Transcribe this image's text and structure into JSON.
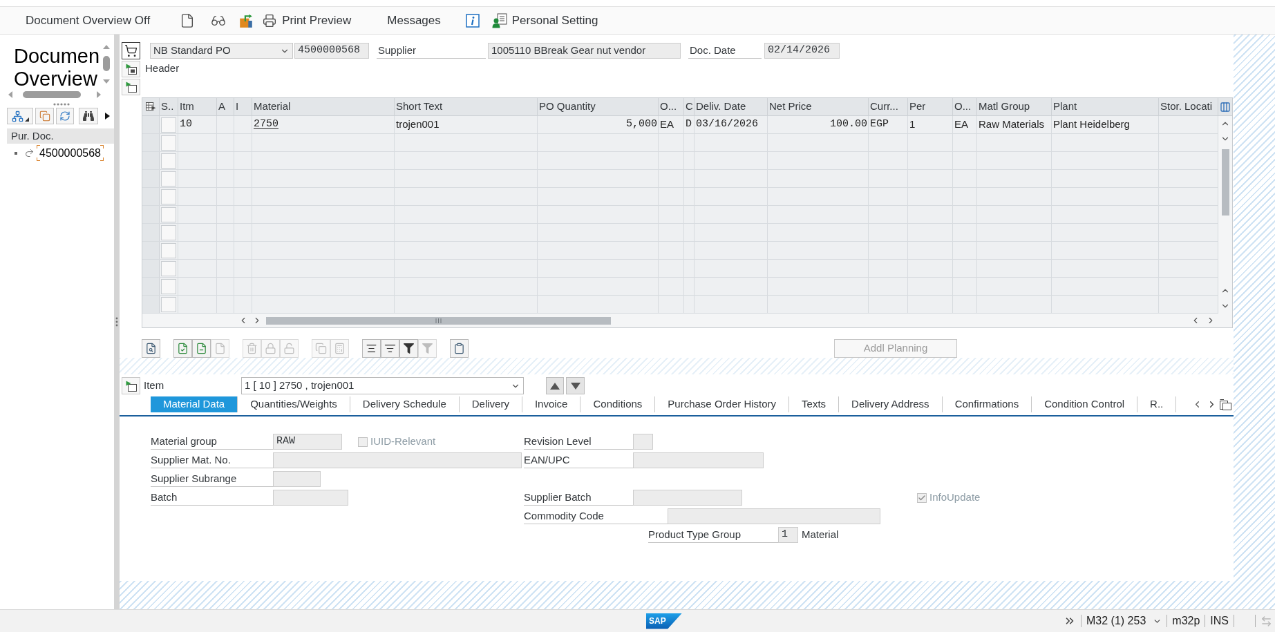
{
  "toolbar": {
    "buttons": [
      {
        "label": "Document Overview Off"
      },
      {
        "label": "Print Preview"
      },
      {
        "label": "Messages"
      },
      {
        "label": "Personal Setting"
      }
    ]
  },
  "document_overview": {
    "title_lines": [
      "Documen",
      "Overview"
    ],
    "tree_header": "Pur. Doc.",
    "tree": [
      {
        "label": "4500000568",
        "selected": true
      }
    ]
  },
  "header": {
    "doc_type": "NB Standard PO",
    "doc_number": "4500000568",
    "supplier_label": "Supplier",
    "supplier": "1005110 BBreak Gear nut vendor",
    "doc_date_label": "Doc. Date",
    "doc_date": "02/14/2026",
    "section_label": "Header"
  },
  "items_table": {
    "columns": [
      "S..",
      "Itm",
      "A",
      "I",
      "Material",
      "Short Text",
      "PO Quantity",
      "O...",
      "C",
      "Deliv. Date",
      "Net Price",
      "Curr...",
      "Per",
      "O...",
      "Matl Group",
      "Plant",
      "Stor. Locati"
    ],
    "rows": [
      {
        "cells": [
          null,
          "10",
          null,
          null,
          "2750",
          "trojen001",
          "5,000",
          "EA",
          "D",
          "03/16/2026",
          "100.00",
          "EGP",
          "1",
          "EA",
          "Raw Materials",
          "Plant Heidelberg",
          null
        ]
      }
    ]
  },
  "table_toolbar": {
    "tools": [
      {
        "disabled": false
      },
      {
        "disabled": false
      },
      {
        "disabled": false
      },
      {
        "disabled": true
      },
      {
        "disabled": true
      },
      {
        "disabled": true
      },
      {
        "disabled": true
      },
      {
        "disabled": true
      },
      {
        "disabled": true
      },
      {
        "disabled": false
      },
      {
        "disabled": false
      },
      {
        "disabled": false
      },
      {
        "disabled": true
      },
      {
        "disabled": false
      }
    ],
    "addl_planning": {
      "label": "Addl Planning",
      "disabled": true
    }
  },
  "item_selector": {
    "label": "Item",
    "value": "1 [ 10 ] 2750 , trojen001"
  },
  "tabs": [
    {
      "label": "Material Data",
      "selected": true
    },
    {
      "label": "Quantities/Weights",
      "selected": false
    },
    {
      "label": "Delivery Schedule",
      "selected": false
    },
    {
      "label": "Delivery",
      "selected": false
    },
    {
      "label": "Invoice",
      "selected": false
    },
    {
      "label": "Conditions",
      "selected": false
    },
    {
      "label": "Purchase Order History",
      "selected": false
    },
    {
      "label": "Texts",
      "selected": false
    },
    {
      "label": "Delivery Address",
      "selected": false
    },
    {
      "label": "Confirmations",
      "selected": false
    },
    {
      "label": "Condition Control",
      "selected": false
    },
    {
      "label": "R..",
      "selected": false
    }
  ],
  "material_data": {
    "material_group": {
      "label": "Material group",
      "value": "RAW"
    },
    "iuid_relevant": {
      "label": "IUID-Relevant",
      "checked": false,
      "disabled": true
    },
    "revision_level": {
      "label": "Revision Level"
    },
    "supplier_mat_no": {
      "label": "Supplier Mat. No."
    },
    "ean_upc": {
      "label": "EAN/UPC"
    },
    "supplier_subrange": {
      "label": "Supplier Subrange"
    },
    "batch": {
      "label": "Batch"
    },
    "supplier_batch": {
      "label": "Supplier Batch"
    },
    "info_update": {
      "label": "InfoUpdate",
      "checked": true,
      "disabled": true
    },
    "commodity_code": {
      "label": "Commodity Code"
    },
    "product_type_group": {
      "label": "Product Type Group",
      "value": "1",
      "description": "Material"
    }
  },
  "status_bar": {
    "logo": "SAP",
    "session": "M32 (1) 253",
    "server": "m32p",
    "input_mode": "INS"
  }
}
